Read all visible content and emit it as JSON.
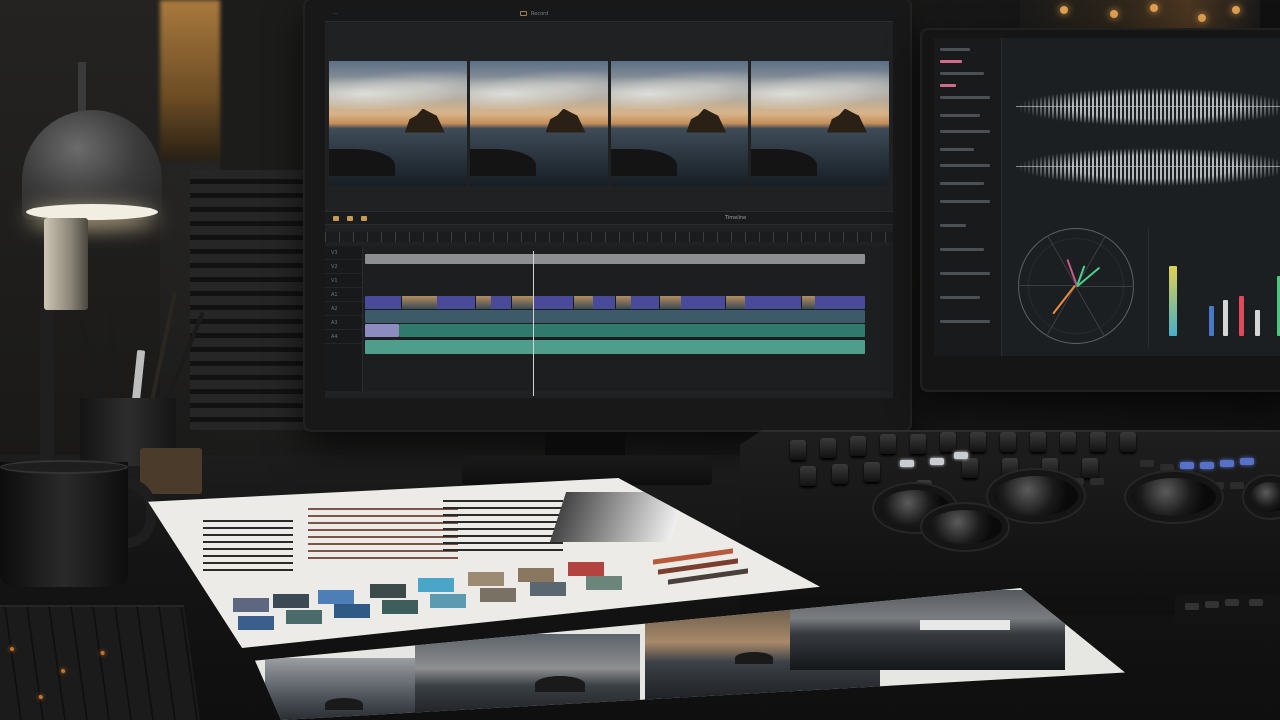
{
  "scene": "Video editing desk with a color-grading control surface",
  "main_monitor": {
    "top_center_label": "Record",
    "timeline_title": "Timeline",
    "track_labels": [
      "V3",
      "V2",
      "V1",
      "A1",
      "A2",
      "A3",
      "A4"
    ]
  },
  "colors": {
    "accent_video_clip": "#4a4a9a",
    "accent_audio_clip": "#2f7a6b",
    "scope_green": "#47d18a",
    "scope_orange": "#f08a3c",
    "panel_button_blue": "#5571c8",
    "lamp_glow": "#f2eee2"
  },
  "icons": [
    "lamp",
    "coffee-mug",
    "pen-cup",
    "trackball",
    "knob",
    "vectorscope",
    "waveform",
    "histogram"
  ]
}
